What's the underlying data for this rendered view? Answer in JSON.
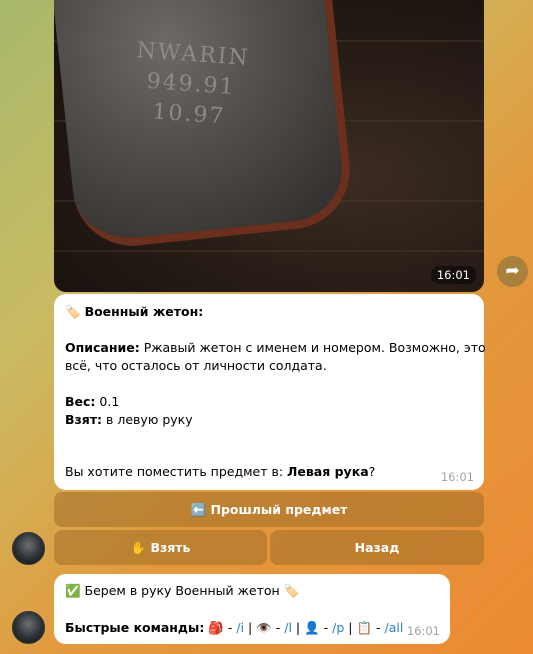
{
  "photo": {
    "time": "16:01",
    "engraving": [
      "NWARIN",
      "949.91",
      "10.97"
    ]
  },
  "item_message": {
    "title": "Военный жетон:",
    "desc_label": "Описание:",
    "desc_text_1": " Ржавый жетон с именем и номером. Возможно, это",
    "desc_text_2": "всё, что осталось от личности солдата.",
    "weight_label": "Вес:",
    "weight_value": " 0.1",
    "taken_label": "Взят:",
    "taken_value": " в левую руку",
    "question_prefix": "Вы хотите поместить предмет в: ",
    "question_target": "Левая рука",
    "question_suffix": "?",
    "time": "16:01"
  },
  "buttons": {
    "prev": "⬅️ Прошлый предмет",
    "take": "✋ Взять",
    "back": "Назад"
  },
  "result_message": {
    "text": "✅ Берем в руку Военный жетон 🏷️",
    "quick_label": "Быстрые команды:",
    "cmd_i": "/i",
    "cmd_l": "/l",
    "cmd_p": "/p",
    "cmd_all": "/all",
    "time": "16:01"
  },
  "icons": {
    "share": "share-arrow-icon",
    "tag": "tag-emoji-icon"
  }
}
